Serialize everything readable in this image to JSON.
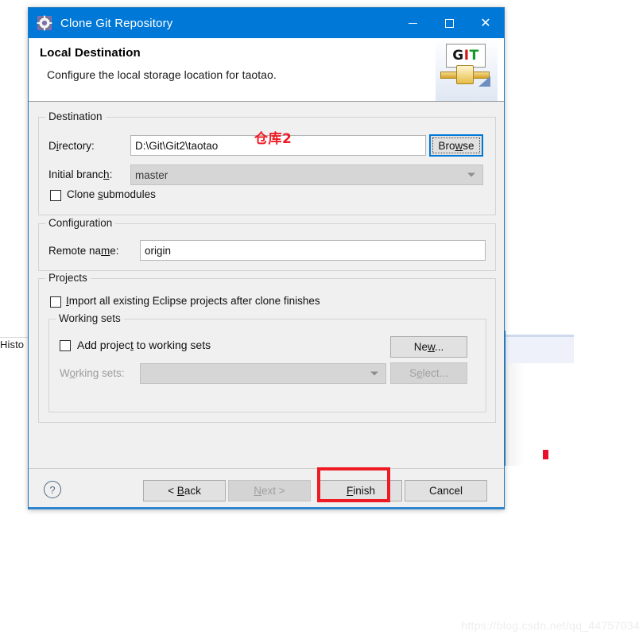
{
  "background": {
    "history_tab_label": "Histo",
    "red_marker": "#e8102a"
  },
  "dialog": {
    "titlebar": {
      "title": "Clone Git Repository",
      "icon": "git-repository-icon",
      "accent_color": "#0078d7",
      "minimize_label": "—",
      "maximize_label": "□",
      "close_label": "✕"
    },
    "header": {
      "title": "Local Destination",
      "subtitle": "Configure the local storage location for taotao.",
      "logo": {
        "g": "G",
        "i": "I",
        "t": "T"
      }
    },
    "destination": {
      "group_title": "Destination",
      "directory_label_pre": "D",
      "directory_label_mnemonic": "i",
      "directory_label_post": "rectory:",
      "directory_value": "D:\\Git\\Git2\\taotao",
      "browse_pre": "Bro",
      "browse_mnemonic": "w",
      "browse_post": "se",
      "branch_label_pre": "Initial branc",
      "branch_label_mnemonic": "h",
      "branch_label_post": ":",
      "branch_value": "master",
      "clone_submodules_pre": "Clone ",
      "clone_submodules_mnemonic": "s",
      "clone_submodules_post": "ubmodules",
      "clone_submodules_checked": false
    },
    "configuration": {
      "group_title": "Configuration",
      "remote_label_pre": "Remote na",
      "remote_label_mnemonic": "m",
      "remote_label_post": "e:",
      "remote_value": "origin"
    },
    "projects": {
      "group_title": "Projects",
      "import_pre": "",
      "import_mnemonic": "I",
      "import_post": "mport all existing Eclipse projects after clone finishes",
      "import_checked": false,
      "working_sets": {
        "group_title": "Working sets",
        "add_pre": "Add projec",
        "add_mnemonic": "t",
        "add_post": " to working sets",
        "add_checked": false,
        "new_pre": "Ne",
        "new_mnemonic": "w",
        "new_post": "...",
        "label_pre": "W",
        "label_mnemonic": "o",
        "label_post": "rking sets:",
        "value": "",
        "select_pre": "S",
        "select_mnemonic": "e",
        "select_post": "lect..."
      }
    },
    "footer": {
      "help_label": "?",
      "back_pre": "< ",
      "back_mnemonic": "B",
      "back_post": "ack",
      "next_pre": "",
      "next_mnemonic": "N",
      "next_post": "ext >",
      "finish_pre": "",
      "finish_mnemonic": "F",
      "finish_post": "inish",
      "cancel_label": "Cancel"
    }
  },
  "annotations": {
    "repo_label": "仓库2",
    "highlight_color": "#ee1b24"
  },
  "watermark": "https://blog.csdn.net/qq_44757034"
}
